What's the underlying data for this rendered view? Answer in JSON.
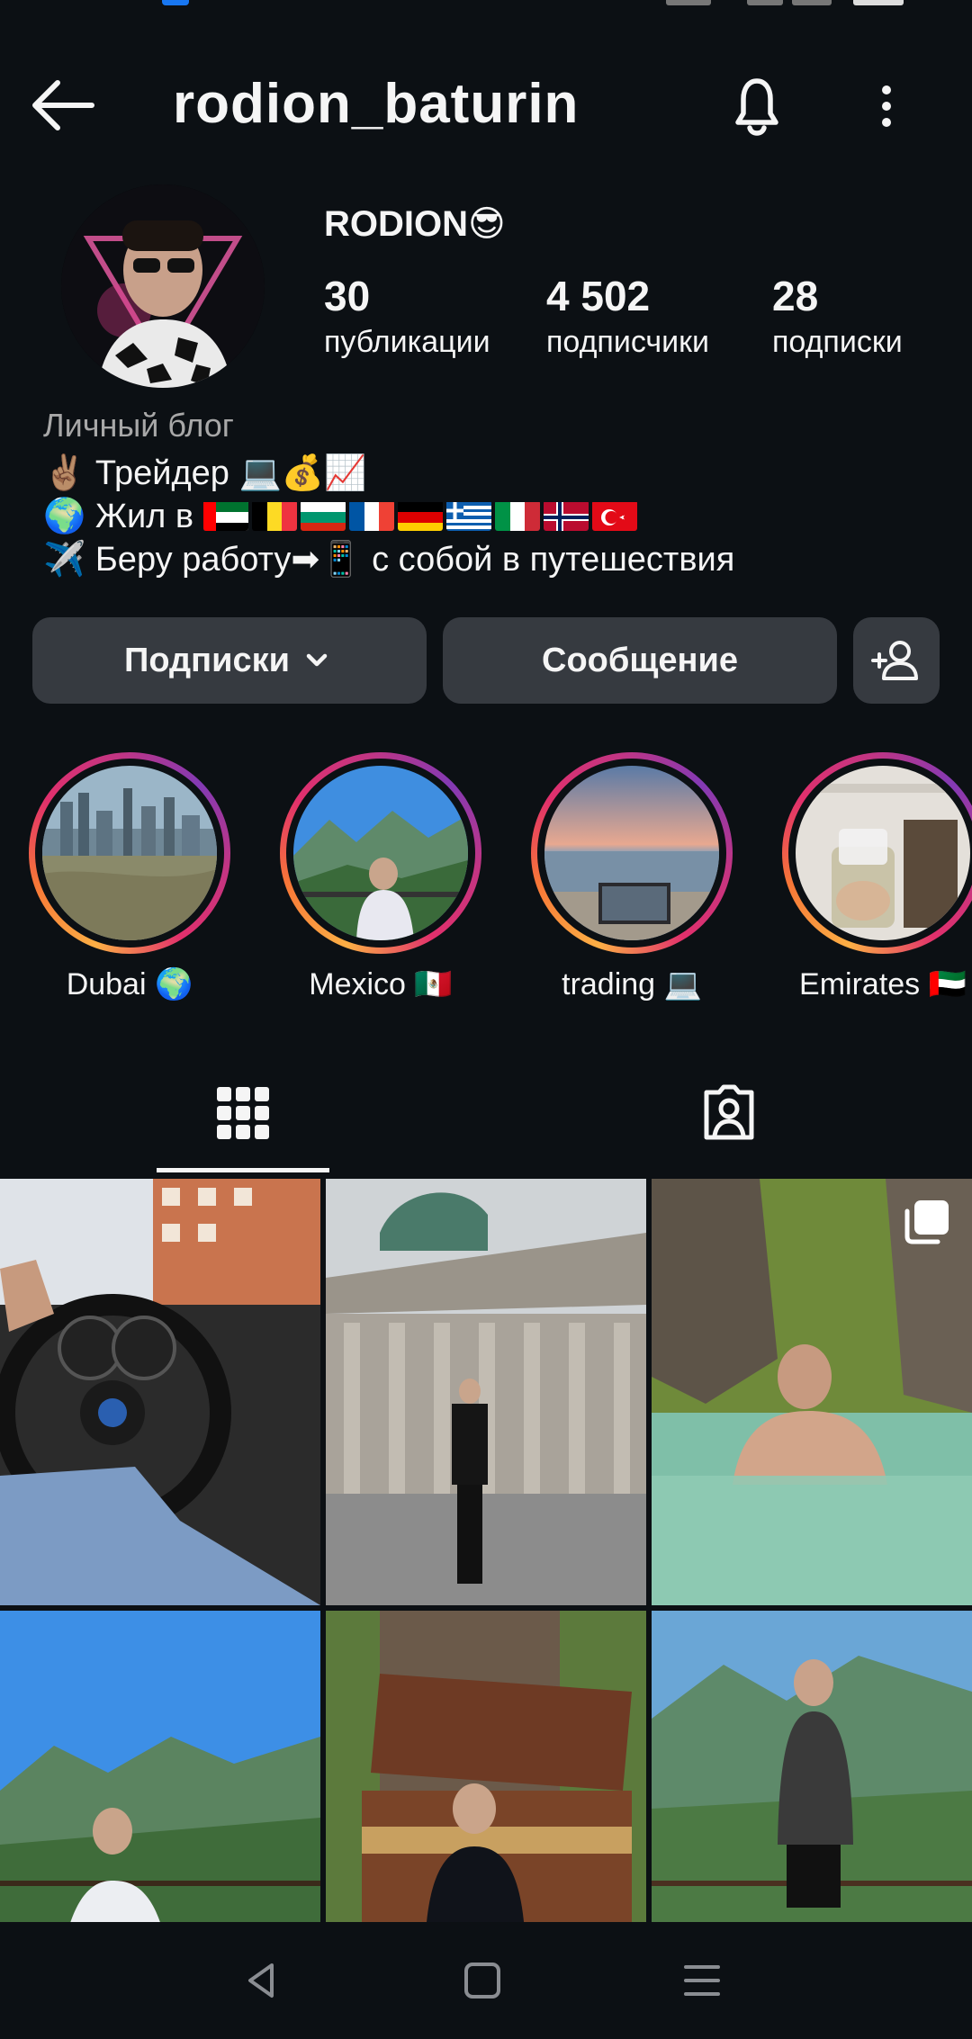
{
  "profile": {
    "username": "rodion_baturin",
    "display_name": "RODION😎",
    "stats": [
      {
        "value": "30",
        "label": "публикации"
      },
      {
        "value": "4 502",
        "label": "подписчики"
      },
      {
        "value": "28",
        "label": "подписки"
      }
    ],
    "category": "Личный блог",
    "bio": {
      "line1": "✌🏽 Трейдер 💻💰📈",
      "line2": "🌍 Жил в",
      "line3": "✈️ Беру работу➡📱 с собой в путешествия"
    }
  },
  "actions": {
    "following_label": "Подписки",
    "message_label": "Сообщение"
  },
  "highlights": [
    {
      "label": "Dubai 🌍"
    },
    {
      "label": "Mexico 🇲🇽"
    },
    {
      "label": "trading 💻"
    },
    {
      "label": "Emirates 🇦🇪"
    }
  ],
  "icons": {
    "back": "arrow-left-icon",
    "bell": "bell-icon",
    "more": "more-vertical-icon",
    "chevron": "chevron-down-icon",
    "add_person": "add-person-icon",
    "grid": "grid-icon",
    "tagged": "tagged-person-icon",
    "carousel": "carousel-icon",
    "nav_back": "nav-back-icon",
    "nav_home": "nav-home-icon",
    "nav_menu": "nav-menu-icon"
  },
  "colors": {
    "background": "#0c1014",
    "button": "#363a40",
    "secondary_text": "#a8a8a8"
  }
}
